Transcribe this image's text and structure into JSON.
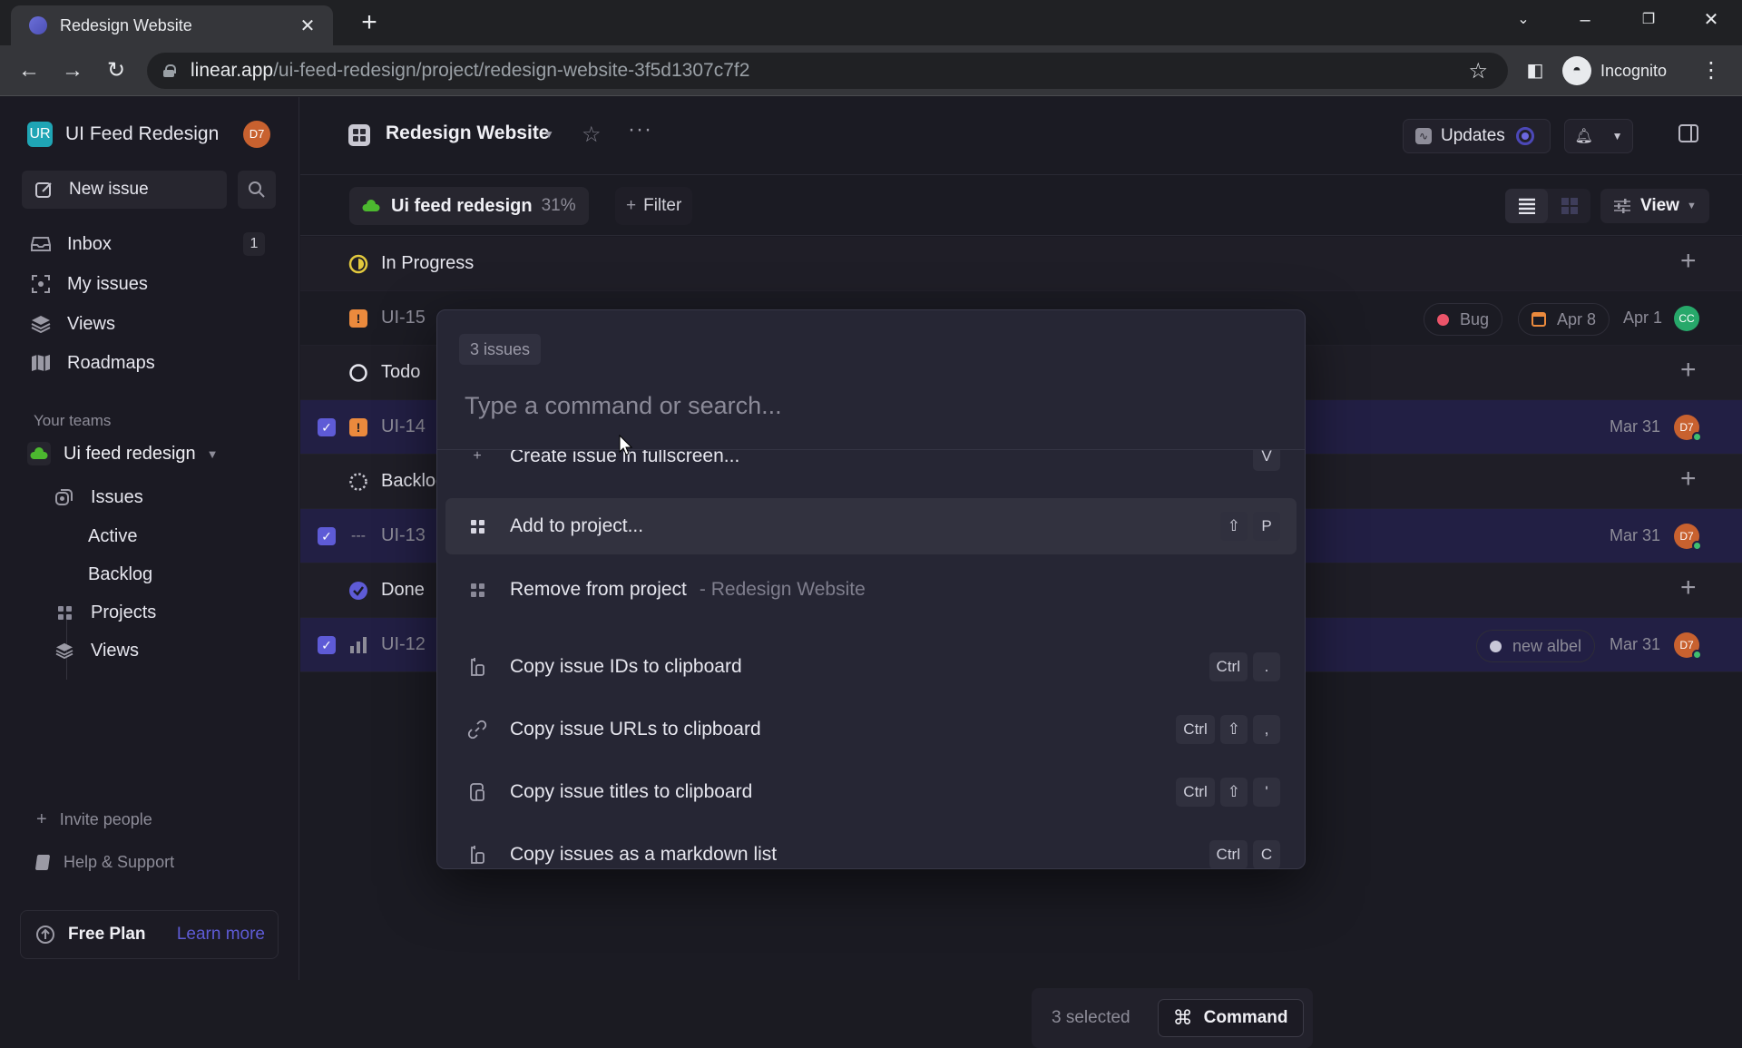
{
  "browser": {
    "tab_title": "Redesign Website",
    "url_host": "linear.app",
    "url_path": "/ui-feed-redesign/project/redesign-website-3f5d1307c7f2",
    "profile_label": "Incognito"
  },
  "sidebar": {
    "workspace_initials": "UR",
    "workspace_name": "UI Feed Redesign",
    "user_initials": "D7",
    "new_issue_label": "New issue",
    "nav": [
      {
        "label": "Inbox",
        "icon": "inbox-icon",
        "badge": "1"
      },
      {
        "label": "My issues",
        "icon": "my-issues-icon"
      },
      {
        "label": "Views",
        "icon": "views-icon"
      },
      {
        "label": "Roadmaps",
        "icon": "roadmap-icon"
      }
    ],
    "teams_heading": "Your teams",
    "team_name": "Ui feed redesign",
    "team_items": [
      {
        "label": "Issues"
      },
      {
        "label": "Active"
      },
      {
        "label": "Backlog"
      },
      {
        "label": "Projects"
      },
      {
        "label": "Views"
      }
    ],
    "invite_label": "Invite people",
    "help_label": "Help & Support",
    "plan_label": "Free Plan",
    "plan_link": "Learn more"
  },
  "header": {
    "project_title": "Redesign Website",
    "updates_label": "Updates"
  },
  "filterbar": {
    "team_chip": "Ui feed redesign",
    "progress_percent": "31%",
    "filter_label": "Filter",
    "view_label": "View"
  },
  "list": {
    "groups": [
      {
        "name": "In Progress",
        "issues": [
          {
            "id": "UI-15",
            "priority": "urgent",
            "selected": false,
            "labels": [
              {
                "name": "Bug",
                "color": "#eb5469"
              }
            ],
            "due": "Apr 8",
            "created": "Apr 1",
            "assignee": "CC",
            "assignee_color": "#27a86a"
          }
        ]
      },
      {
        "name": "Todo",
        "issues": [
          {
            "id": "UI-14",
            "priority": "urgent",
            "selected": true,
            "labels": [],
            "created": "Mar 31",
            "assignee": "D7",
            "assignee_color": "#c8612f"
          }
        ]
      },
      {
        "name": "Backlog",
        "issues": [
          {
            "id": "UI-13",
            "priority": "none",
            "selected": true,
            "labels": [],
            "created": "Mar 31",
            "assignee": "D7",
            "assignee_color": "#c8612f"
          }
        ]
      },
      {
        "name": "Done",
        "issues": [
          {
            "id": "UI-12",
            "priority": "high",
            "selected": true,
            "labels": [
              {
                "name": "new albel",
                "color": "#c9c8d8"
              }
            ],
            "created": "Mar 31",
            "assignee": "D7",
            "assignee_color": "#c8612f"
          }
        ]
      }
    ]
  },
  "selection_bar": {
    "count_label": "3 selected",
    "command_label": "Command"
  },
  "palette": {
    "scope_label": "3 issues",
    "placeholder": "Type a command or search...",
    "items": [
      {
        "label": "Create issue in fullscreen...",
        "icon": "create-fullscreen-icon",
        "keys": [
          "V"
        ],
        "partial": true
      },
      {
        "label": "Add to project...",
        "icon": "project-icon",
        "keys": [
          "⇧",
          "P"
        ],
        "hover": true
      },
      {
        "label": "Remove from project",
        "suffix": "- Redesign Website",
        "icon": "project-icon",
        "keys": []
      },
      {
        "label": "Copy issue IDs to clipboard",
        "icon": "clipboard-icon",
        "keys": [
          "Ctrl",
          "."
        ]
      },
      {
        "label": "Copy issue URLs to clipboard",
        "icon": "link-icon",
        "keys": [
          "Ctrl",
          "⇧",
          ","
        ]
      },
      {
        "label": "Copy issue titles to clipboard",
        "icon": "clipboard-icon",
        "keys": [
          "Ctrl",
          "⇧",
          "'"
        ]
      },
      {
        "label": "Copy issues as a markdown list",
        "icon": "clipboard-icon",
        "keys": [
          "Ctrl",
          "C"
        ]
      }
    ]
  },
  "colors": {
    "accent": "#5e5bd6",
    "selected_row": "#221f44",
    "urgent": "#eb8a3d",
    "in_progress": "#e2c93d",
    "team": "#4cb82f"
  }
}
